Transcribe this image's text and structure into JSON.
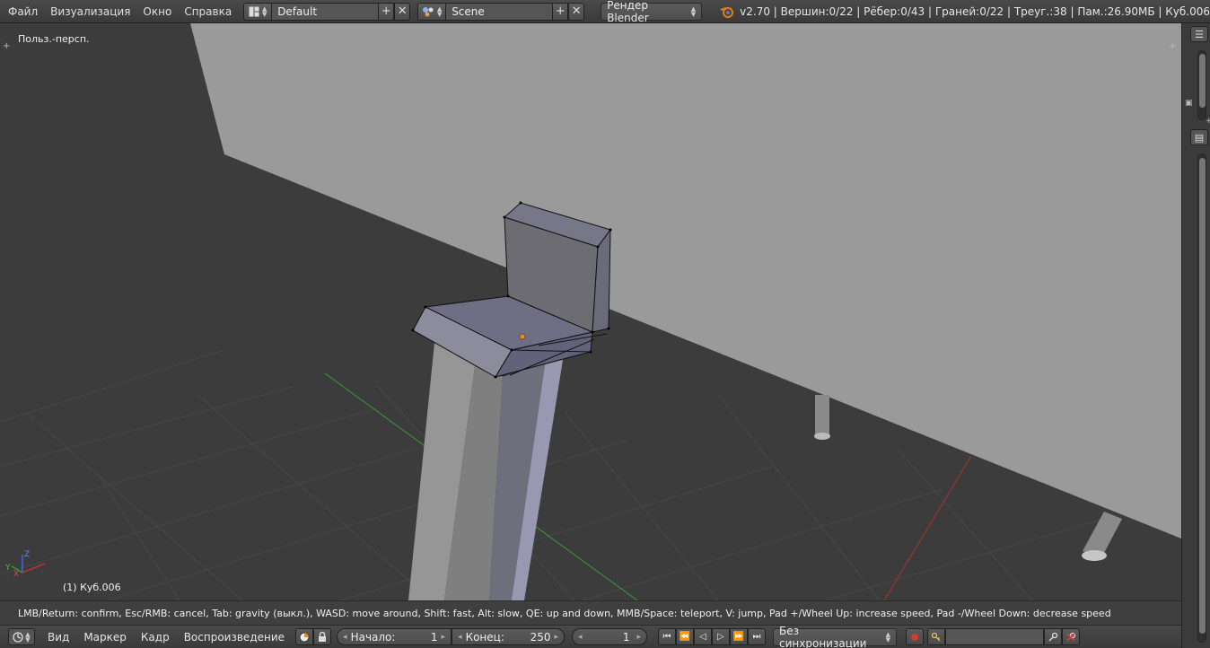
{
  "menu": {
    "file": "Файл",
    "render": "Визуализация",
    "window": "Окно",
    "help": "Справка"
  },
  "layout": {
    "name": "Default",
    "icon": "layout-icon"
  },
  "scene": {
    "name": "Scene",
    "icon": "scene-icon"
  },
  "render_engine": "Рендер Blender",
  "stats": "v2.70 | Вершин:0/22 | Рёбер:0/43 | Граней:0/22 | Треуг.:38 | Пам.:26.90МБ | Куб.006",
  "viewport": {
    "view_name": "Польз.-персп.",
    "object_label": "(1) Куб.006",
    "axis_x": "X",
    "axis_y": "Y",
    "axis_z": "Z"
  },
  "operator_status": "LMB/Return: confirm, Esc/RMB: cancel, Tab: gravity (выкл.), WASD: move around, Shift: fast, Alt: slow, QE: up and down, MMB/Space: teleport, V: jump, Pad +/Wheel Up: increase speed, Pad -/Wheel Down: decrease speed",
  "timeline": {
    "view": "Вид",
    "marker": "Маркер",
    "frame": "Кадр",
    "playback": "Воспроизведение",
    "start_label": "Начало:",
    "start_value": "1",
    "end_label": "Конец:",
    "end_value": "250",
    "current_frame": "1",
    "sync": "Без синхронизации"
  },
  "colors": {
    "background": "#3c3c3c",
    "wall": "#9a9a9a",
    "mesh_face": "#6b6b7a",
    "x_axis": "#b03030",
    "y_axis": "#3a9a3a",
    "selection_origin": "#f08a20"
  }
}
